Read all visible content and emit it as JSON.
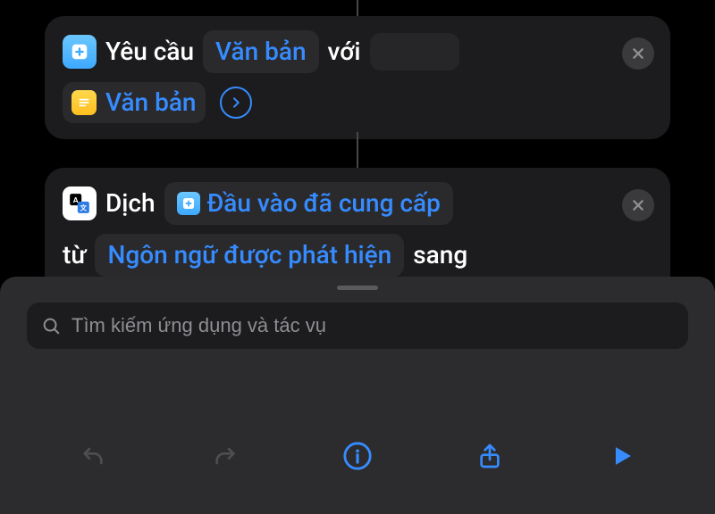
{
  "card1": {
    "action_label": "Yêu cầu",
    "token_text": "Văn bản",
    "with_label": "với",
    "token2_text": "Văn bản"
  },
  "card2": {
    "action_label": "Dịch",
    "input_token": "Đầu vào đã cung cấp",
    "from_label": "từ",
    "lang_token": "Ngôn ngữ được phát hiện",
    "to_label": "sang"
  },
  "search": {
    "placeholder": "Tìm kiếm ứng dụng và tác vụ"
  },
  "icons": {
    "ask": "plus-square-icon",
    "text": "text-lines-icon",
    "translate": "translate-icon",
    "chevron": "chevron-right-icon",
    "close": "close-icon",
    "search": "search-icon",
    "undo": "undo-icon",
    "redo": "redo-icon",
    "info": "info-icon",
    "share": "share-icon",
    "play": "play-icon"
  },
  "colors": {
    "accent": "#368cff",
    "card_bg": "#1c1c1e",
    "sheet_bg": "#2c2c2e"
  }
}
